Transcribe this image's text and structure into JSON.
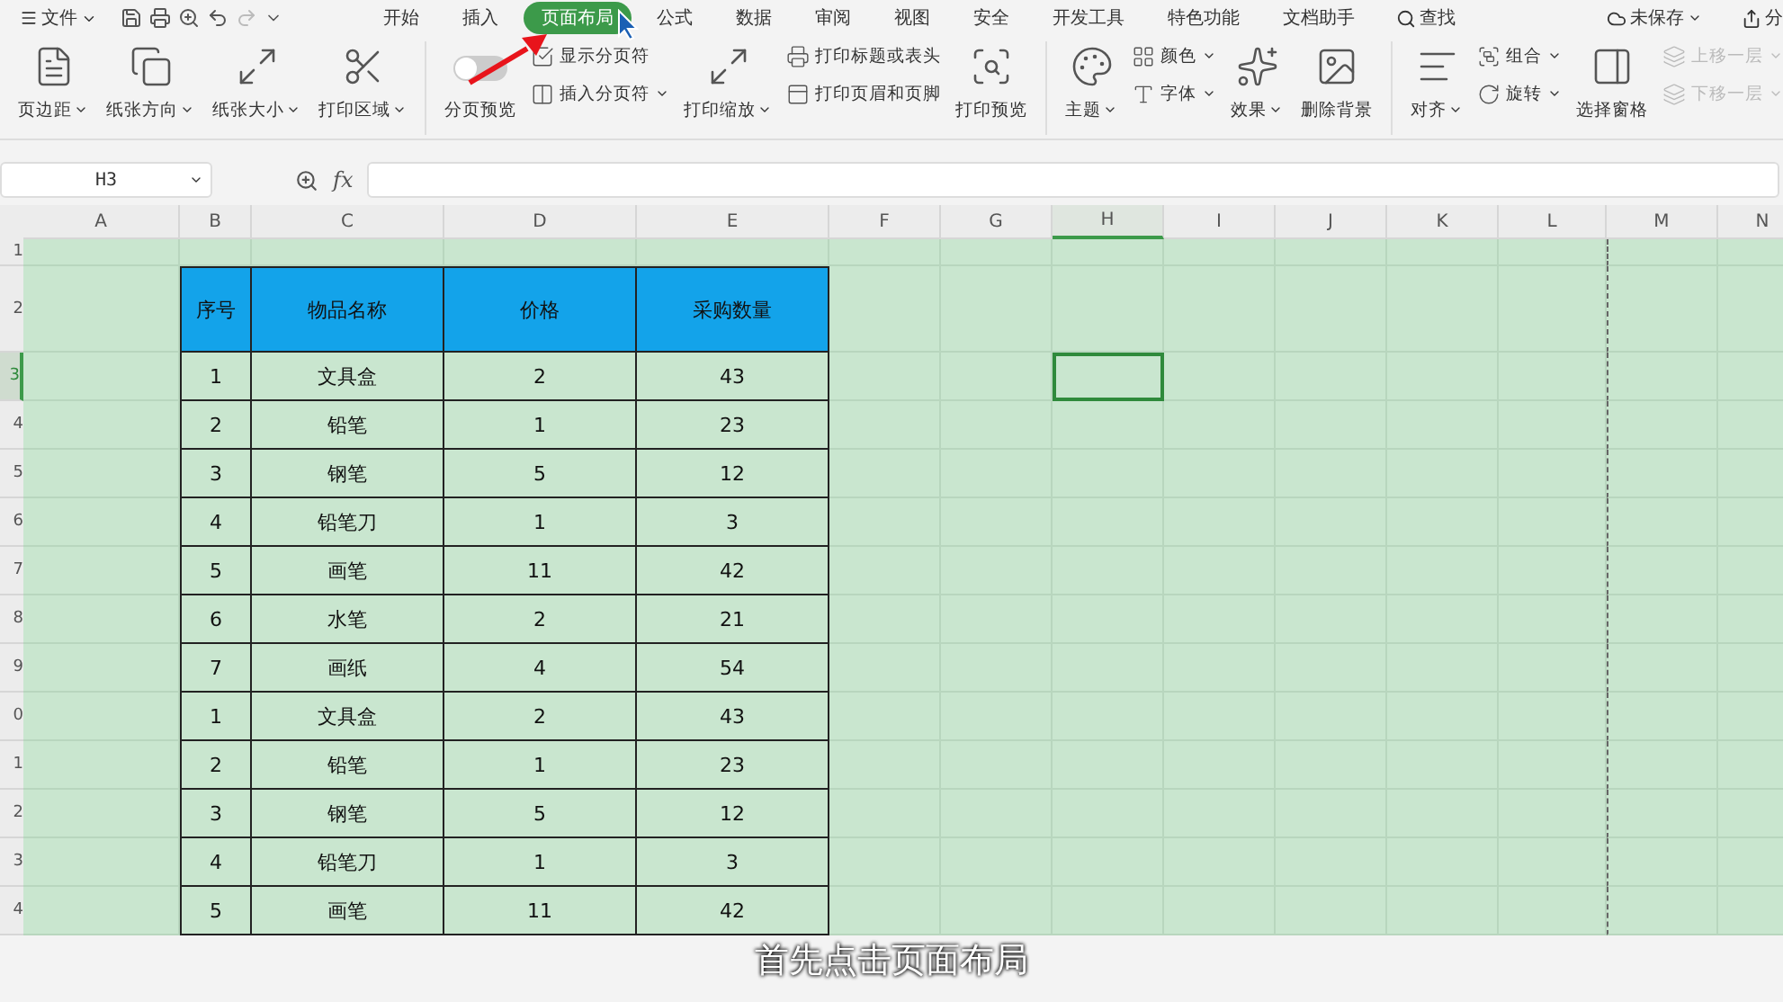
{
  "menu_bar": {
    "file": "文件",
    "tabs": [
      {
        "label": "开始",
        "selected": false
      },
      {
        "label": "插入",
        "selected": false
      },
      {
        "label": "页面布局",
        "selected": true
      },
      {
        "label": "公式",
        "selected": false
      },
      {
        "label": "数据",
        "selected": false
      },
      {
        "label": "审阅",
        "selected": false
      },
      {
        "label": "视图",
        "selected": false
      },
      {
        "label": "安全",
        "selected": false
      },
      {
        "label": "开发工具",
        "selected": false
      },
      {
        "label": "特色功能",
        "selected": false
      },
      {
        "label": "文档助手",
        "selected": false
      }
    ],
    "search": "查找",
    "save_status": "未保存",
    "share": "分"
  },
  "ribbon": [
    [
      {
        "kind": "large",
        "label": "页边距",
        "dropdown": true
      },
      {
        "kind": "large",
        "label": "纸张方向",
        "dropdown": true
      },
      {
        "kind": "large",
        "label": "纸张大小",
        "dropdown": true
      },
      {
        "kind": "large",
        "label": "打印区域",
        "dropdown": true
      }
    ],
    [
      {
        "kind": "toggle",
        "label": "分页预览",
        "on": false
      },
      {
        "kind": "stack",
        "items": [
          {
            "label": "显示分页符",
            "dropdown": false,
            "disabled": false
          },
          {
            "label": "插入分页符",
            "dropdown": true,
            "disabled": false
          }
        ]
      },
      {
        "kind": "large",
        "label": "打印缩放",
        "dropdown": true
      },
      {
        "kind": "stack",
        "items": [
          {
            "label": "打印标题或表头",
            "dropdown": false,
            "disabled": false
          },
          {
            "label": "打印页眉和页脚",
            "dropdown": false,
            "disabled": false
          }
        ]
      },
      {
        "kind": "large",
        "label": "打印预览",
        "dropdown": false
      }
    ],
    [
      {
        "kind": "large",
        "label": "主题",
        "dropdown": true
      },
      {
        "kind": "stack",
        "items": [
          {
            "label": "颜色",
            "dropdown": true,
            "disabled": false
          },
          {
            "label": "字体",
            "dropdown": true,
            "disabled": false
          }
        ]
      },
      {
        "kind": "large",
        "label": "效果",
        "dropdown": true
      },
      {
        "kind": "large",
        "label": "删除背景",
        "dropdown": false
      }
    ],
    [
      {
        "kind": "large",
        "label": "对齐",
        "dropdown": true
      },
      {
        "kind": "stack",
        "items": [
          {
            "label": "组合",
            "dropdown": true,
            "disabled": false
          },
          {
            "label": "旋转",
            "dropdown": true,
            "disabled": false
          }
        ]
      },
      {
        "kind": "large",
        "label": "选择窗格",
        "dropdown": false
      },
      {
        "kind": "stack",
        "items": [
          {
            "label": "上移一层",
            "dropdown": true,
            "disabled": true
          },
          {
            "label": "下移一层",
            "dropdown": true,
            "disabled": true
          }
        ]
      }
    ]
  ],
  "formula_bar": {
    "name_box": "H3",
    "fx": "fx"
  },
  "sheet": {
    "columns": [
      {
        "label": "A",
        "selected": false,
        "page_break": false
      },
      {
        "label": "B",
        "selected": false,
        "page_break": false
      },
      {
        "label": "C",
        "selected": false,
        "page_break": false
      },
      {
        "label": "D",
        "selected": false,
        "page_break": false
      },
      {
        "label": "E",
        "selected": false,
        "page_break": false
      },
      {
        "label": "F",
        "selected": false,
        "page_break": false
      },
      {
        "label": "G",
        "selected": false,
        "page_break": false
      },
      {
        "label": "H",
        "selected": true,
        "page_break": false
      },
      {
        "label": "I",
        "selected": false,
        "page_break": false
      },
      {
        "label": "J",
        "selected": false,
        "page_break": false
      },
      {
        "label": "K",
        "selected": false,
        "page_break": false
      },
      {
        "label": "L",
        "selected": false,
        "page_break": false
      },
      {
        "label": "M",
        "selected": false,
        "page_break": true
      },
      {
        "label": "N",
        "selected": false,
        "page_break": false
      }
    ],
    "rows": [
      {
        "label": "1",
        "selected": false
      },
      {
        "label": "2",
        "selected": false
      },
      {
        "label": "3",
        "selected": true
      },
      {
        "label": "4",
        "selected": false
      },
      {
        "label": "5",
        "selected": false
      },
      {
        "label": "6",
        "selected": false
      },
      {
        "label": "7",
        "selected": false
      },
      {
        "label": "8",
        "selected": false
      },
      {
        "label": "9",
        "selected": false
      },
      {
        "label": "0",
        "selected": false
      },
      {
        "label": "1",
        "selected": false
      },
      {
        "label": "2",
        "selected": false
      },
      {
        "label": "3",
        "selected": false
      },
      {
        "label": "4",
        "selected": false
      }
    ],
    "table": {
      "columns": [
        "序号",
        "物品名称",
        "价格",
        "采购数量"
      ],
      "rows": [
        [
          "1",
          "文具盒",
          "2",
          "43"
        ],
        [
          "2",
          "铅笔",
          "1",
          "23"
        ],
        [
          "3",
          "钢笔",
          "5",
          "12"
        ],
        [
          "4",
          "铅笔刀",
          "1",
          "3"
        ],
        [
          "5",
          "画笔",
          "11",
          "42"
        ],
        [
          "6",
          "水笔",
          "2",
          "21"
        ],
        [
          "7",
          "画纸",
          "4",
          "54"
        ],
        [
          "1",
          "文具盒",
          "2",
          "43"
        ],
        [
          "2",
          "铅笔",
          "1",
          "23"
        ],
        [
          "3",
          "钢笔",
          "5",
          "12"
        ],
        [
          "4",
          "铅笔刀",
          "1",
          "3"
        ],
        [
          "5",
          "画笔",
          "11",
          "42"
        ]
      ]
    }
  },
  "caption": "首先点击页面布局"
}
